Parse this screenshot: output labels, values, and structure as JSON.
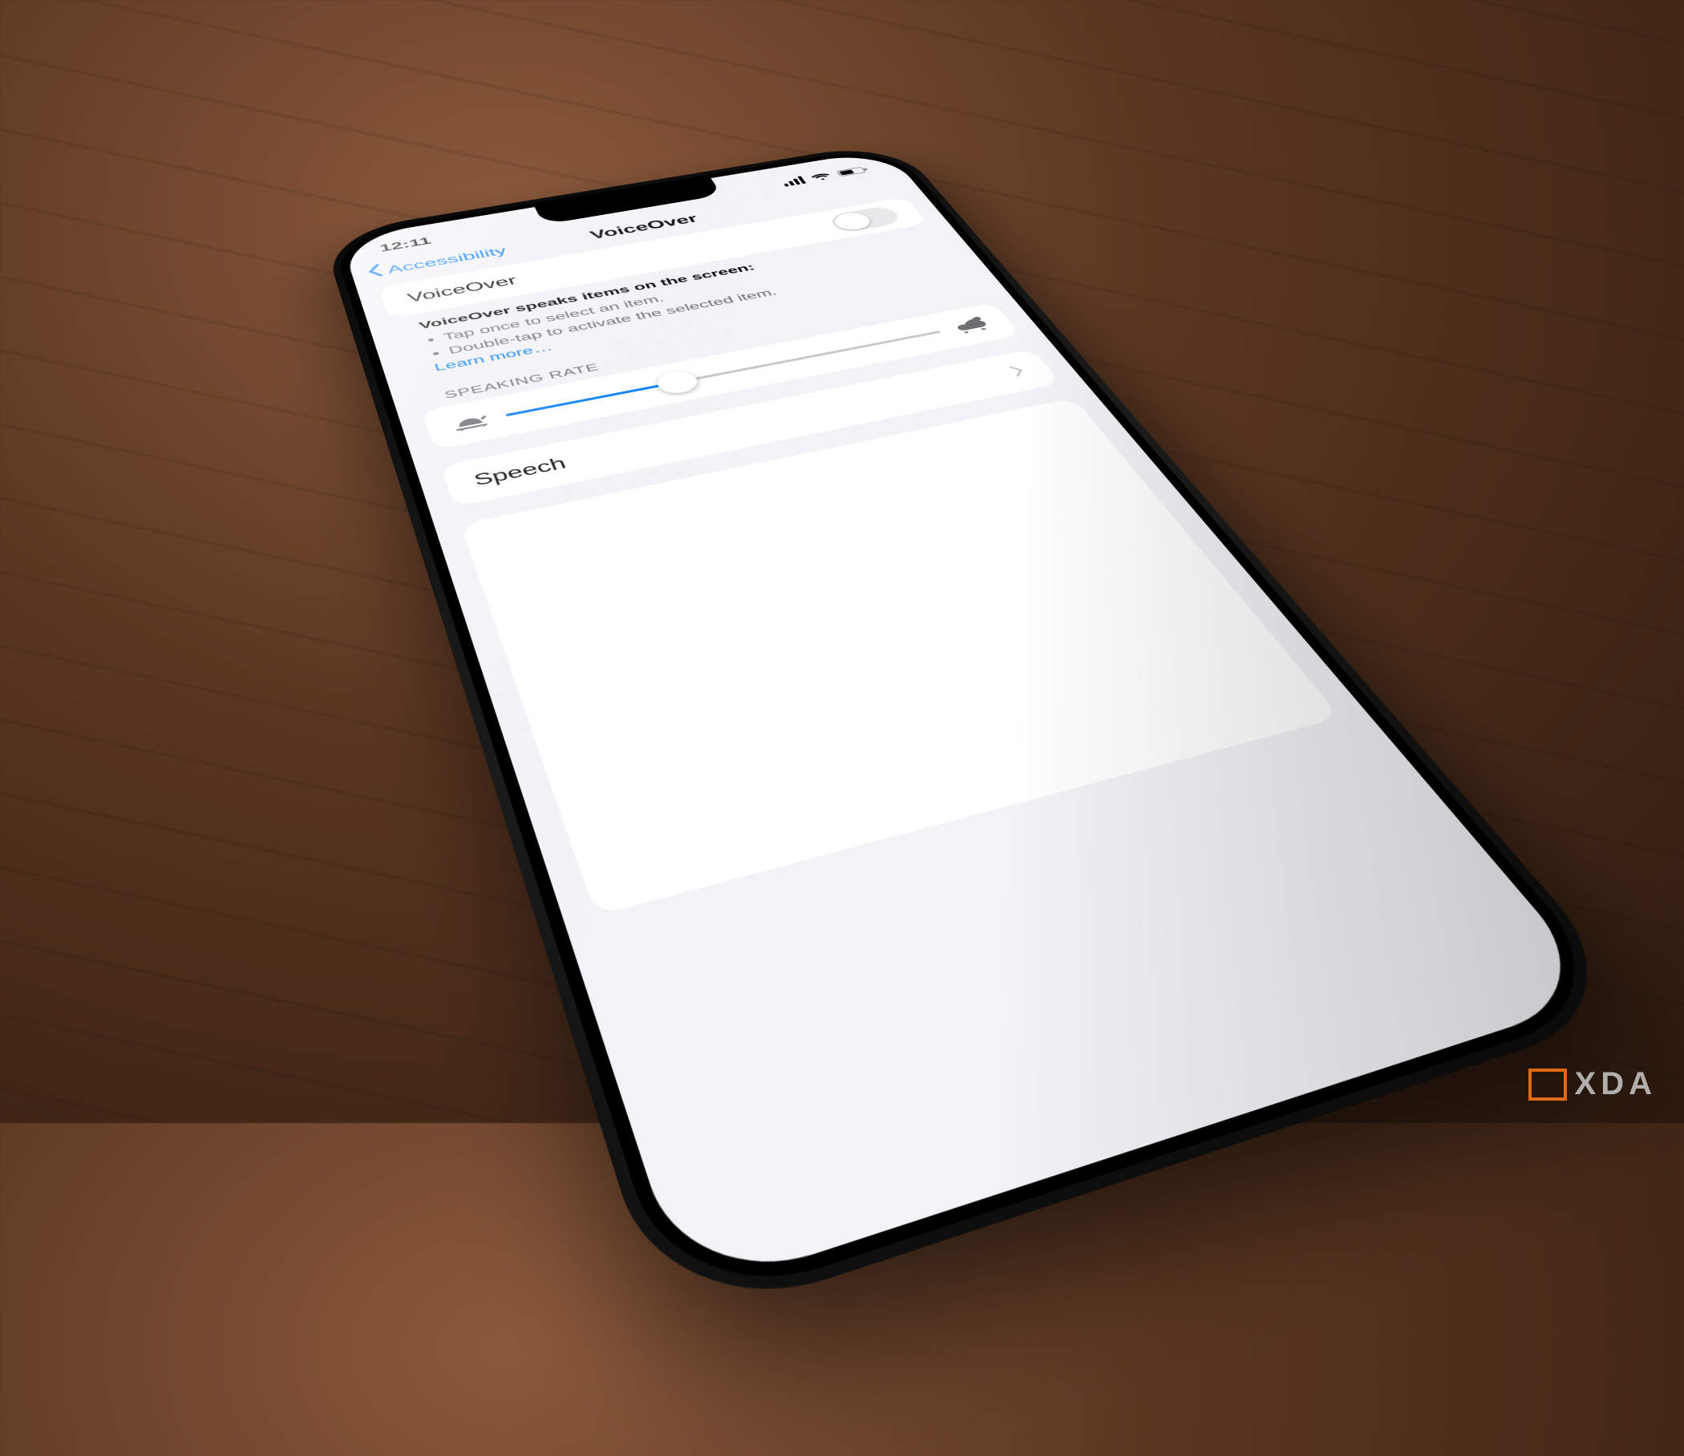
{
  "watermark": "XDA",
  "status": {
    "time": "12:11"
  },
  "nav": {
    "back": "Accessibility",
    "title": "VoiceOver"
  },
  "voiceover": {
    "toggle_label": "VoiceOver",
    "toggle_on": false,
    "desc_lead": "VoiceOver speaks items on the screen:",
    "bullet1": "Tap once to select an item.",
    "bullet2": "Double-tap to activate the selected item.",
    "learn_more": "Learn more…"
  },
  "rate": {
    "header": "SPEAKING RATE",
    "value_percent": 38,
    "slow_icon": "tortoise-icon",
    "fast_icon": "hare-icon"
  },
  "speech": {
    "label": "Speech"
  }
}
